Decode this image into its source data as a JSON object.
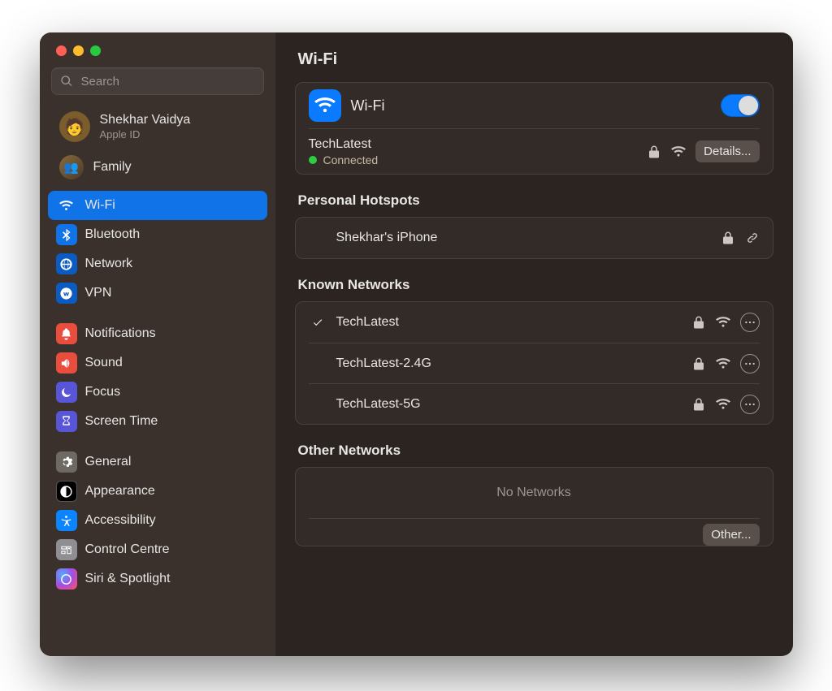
{
  "sidebar": {
    "search_placeholder": "Search",
    "user": {
      "name": "Shekhar Vaidya",
      "sub": "Apple ID"
    },
    "family_label": "Family",
    "groups": [
      {
        "items": [
          {
            "id": "wifi",
            "label": "Wi-Fi",
            "icon": "wifi",
            "selected": true,
            "iconBg": "blue"
          },
          {
            "id": "bluetooth",
            "label": "Bluetooth",
            "icon": "bluetooth",
            "iconBg": "blue"
          },
          {
            "id": "network",
            "label": "Network",
            "icon": "globe",
            "iconBg": "blue-dark"
          },
          {
            "id": "vpn",
            "label": "VPN",
            "icon": "vpn",
            "iconBg": "blue-dark"
          }
        ]
      },
      {
        "items": [
          {
            "id": "notifications",
            "label": "Notifications",
            "icon": "bell",
            "iconBg": "red"
          },
          {
            "id": "sound",
            "label": "Sound",
            "icon": "speaker",
            "iconBg": "red-speaker"
          },
          {
            "id": "focus",
            "label": "Focus",
            "icon": "moon",
            "iconBg": "purple"
          },
          {
            "id": "screentime",
            "label": "Screen Time",
            "icon": "hourglass",
            "iconBg": "purple"
          }
        ]
      },
      {
        "items": [
          {
            "id": "general",
            "label": "General",
            "icon": "gear",
            "iconBg": "gray"
          },
          {
            "id": "appearance",
            "label": "Appearance",
            "icon": "appearance",
            "iconBg": "black"
          },
          {
            "id": "accessibility",
            "label": "Accessibility",
            "icon": "accessibility",
            "iconBg": "cyan"
          },
          {
            "id": "controlcentre",
            "label": "Control Centre",
            "icon": "controlcentre",
            "iconBg": "cc"
          },
          {
            "id": "siri",
            "label": "Siri & Spotlight",
            "icon": "siri",
            "iconBg": "siri"
          }
        ]
      }
    ]
  },
  "main": {
    "title": "Wi-Fi",
    "wifi_card": {
      "label": "Wi-Fi",
      "enabled": true,
      "current_network": "TechLatest",
      "status": "Connected",
      "details_label": "Details..."
    },
    "hotspots": {
      "title": "Personal Hotspots",
      "items": [
        {
          "name": "Shekhar's iPhone",
          "secured": true
        }
      ]
    },
    "known": {
      "title": "Known Networks",
      "items": [
        {
          "name": "TechLatest",
          "connected": true,
          "secured": true
        },
        {
          "name": "TechLatest-2.4G",
          "connected": false,
          "secured": true
        },
        {
          "name": "TechLatest-5G",
          "connected": false,
          "secured": true
        }
      ]
    },
    "other": {
      "title": "Other Networks",
      "empty_label": "No Networks",
      "other_label": "Other..."
    }
  }
}
